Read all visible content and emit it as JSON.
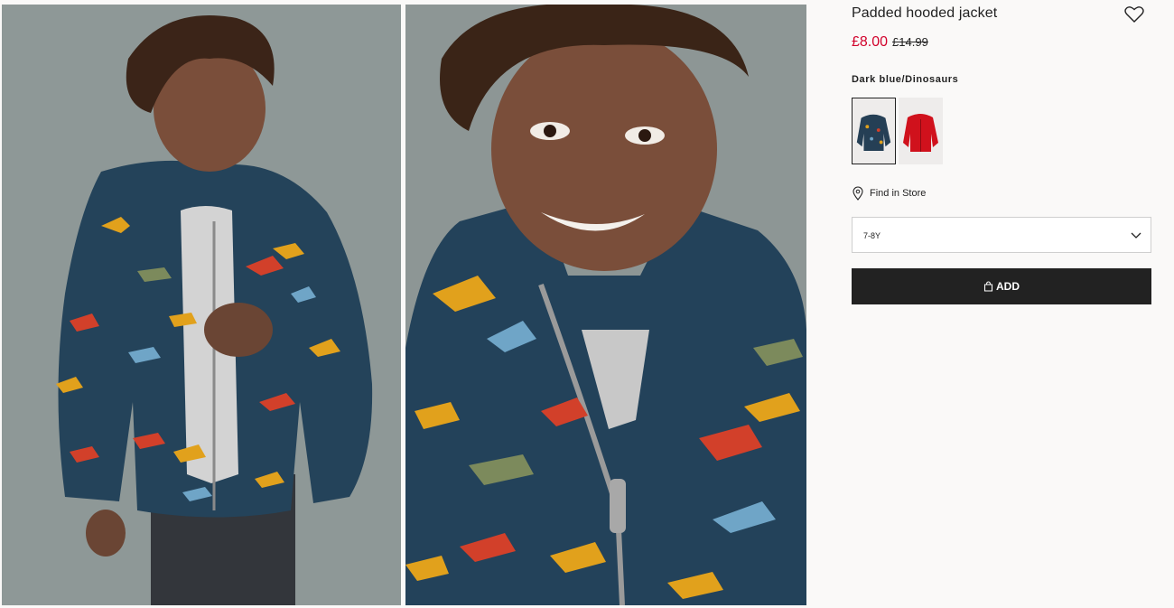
{
  "product": {
    "title": "Padded hooded jacket",
    "price_sale": "£8.00",
    "price_original": "£14.99",
    "color_name": "Dark blue/Dinosaurs",
    "find_in_store": "Find in Store",
    "size_selected": "7-8Y",
    "add_label": "ADD"
  },
  "swatches": [
    {
      "name": "Dark blue/Dinosaurs",
      "color": "#253f55",
      "selected": true
    },
    {
      "name": "Red",
      "color": "#d0111c",
      "selected": false
    }
  ],
  "colors": {
    "sale_price": "#d1022b",
    "button_bg": "#222222",
    "page_bg": "#faf9f8"
  },
  "icons": {
    "favorite": "heart-icon",
    "store": "location-pin-icon",
    "dropdown": "chevron-down-icon",
    "bag": "shopping-bag-icon"
  }
}
